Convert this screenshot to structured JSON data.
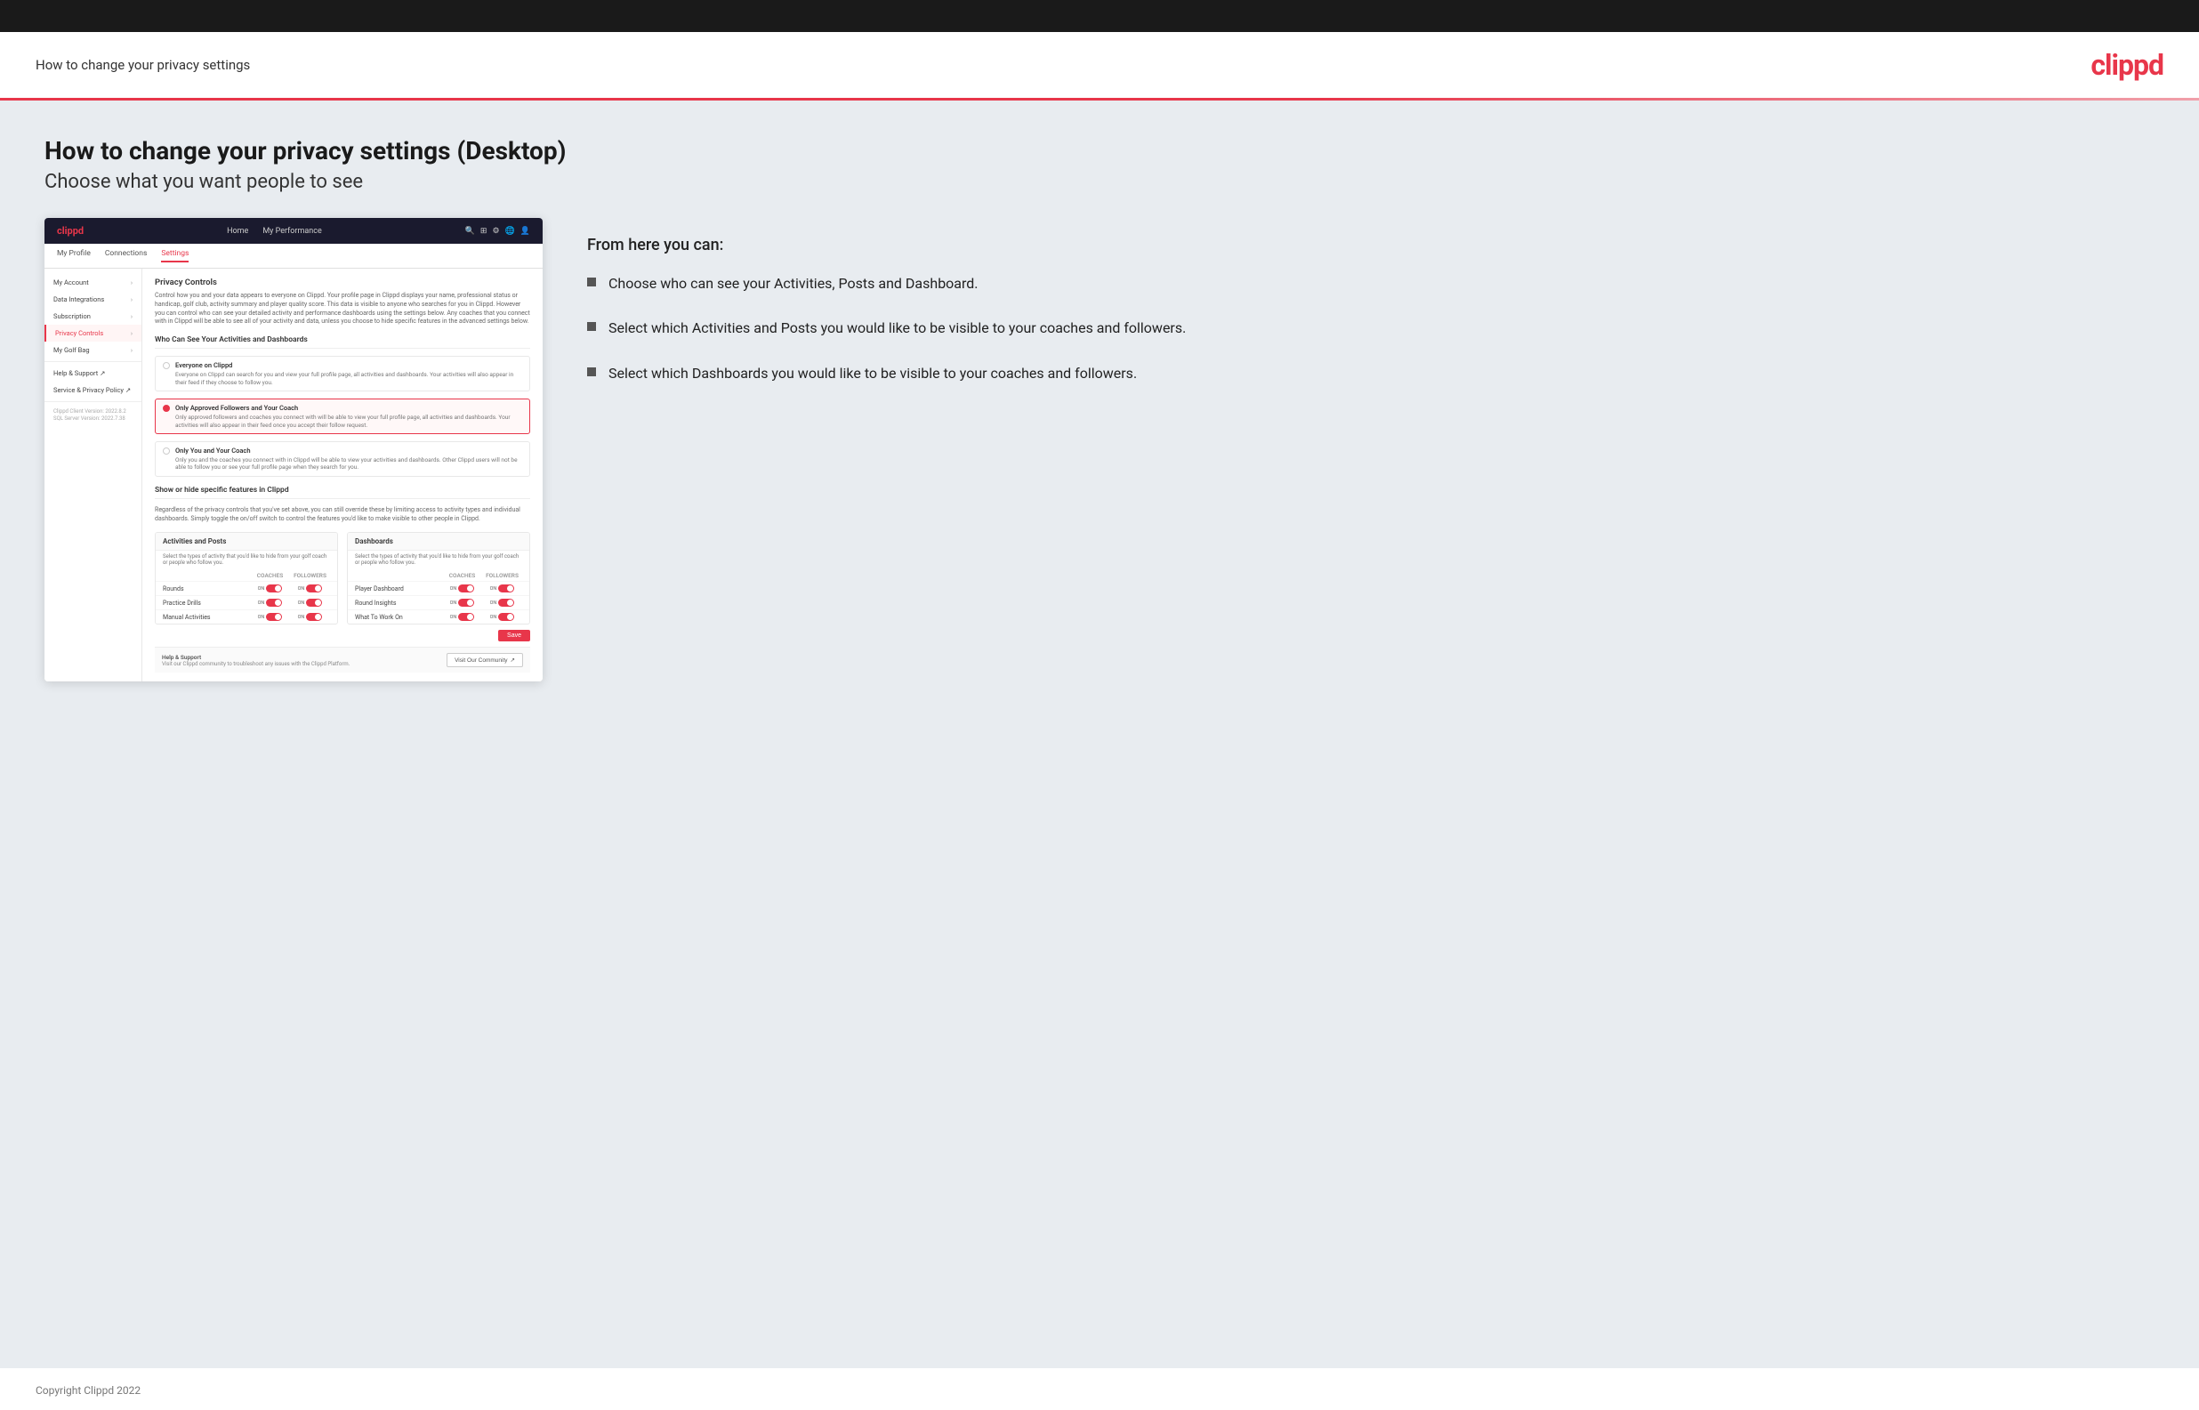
{
  "header": {
    "title": "How to change your privacy settings",
    "logo": "clippd"
  },
  "page": {
    "heading": "How to change your privacy settings (Desktop)",
    "subheading": "Choose what you want people to see"
  },
  "app": {
    "nav": {
      "logo": "clippd",
      "links": [
        "Home",
        "My Performance"
      ],
      "icons": [
        "search",
        "grid",
        "settings",
        "globe",
        "avatar"
      ]
    },
    "subnav": [
      "My Profile",
      "Connections",
      "Settings"
    ],
    "sidebar": {
      "items": [
        {
          "label": "My Account",
          "active": false
        },
        {
          "label": "Data Integrations",
          "active": false
        },
        {
          "label": "Subscription",
          "active": false
        },
        {
          "label": "Privacy Controls",
          "active": true
        },
        {
          "label": "My Golf Bag",
          "active": false
        },
        {
          "label": "Help & Support",
          "active": false,
          "external": true
        },
        {
          "label": "Service & Privacy Policy",
          "active": false,
          "external": true
        }
      ],
      "version": "Clippd Client Version: 2022.8.2\nSQL Server Version: 2022.7.38"
    },
    "main": {
      "privacy_controls_title": "Privacy Controls",
      "privacy_controls_desc": "Control how you and your data appears to everyone on Clippd. Your profile page in Clippd displays your name, professional status or handicap, golf club, activity summary and player quality score. This data is visible to anyone who searches for you in Clippd. However you can control who can see your detailed activity and performance dashboards using the settings below. Any coaches that you connect with in Clippd will be able to see all of your activity and data, unless you choose to hide specific features in the advanced settings below.",
      "who_can_see_title": "Who Can See Your Activities and Dashboards",
      "radio_options": [
        {
          "label": "Everyone on Clippd",
          "desc": "Everyone on Clippd can search for you and view your full profile page, all activities and dashboards. Your activities will also appear in their feed if they choose to follow you.",
          "selected": false
        },
        {
          "label": "Only Approved Followers and Your Coach",
          "desc": "Only approved followers and coaches you connect with will be able to view your full profile page, all activities and dashboards. Your activities will also appear in their feed once you accept their follow request.",
          "selected": true
        },
        {
          "label": "Only You and Your Coach",
          "desc": "Only you and the coaches you connect with in Clippd will be able to view your activities and dashboards. Other Clippd users will not be able to follow you or see your full profile page when they search for you.",
          "selected": false
        }
      ],
      "show_hide_title": "Show or hide specific features in Clippd",
      "show_hide_desc": "Regardless of the privacy controls that you've set above, you can still override these by limiting access to activity types and individual dashboards. Simply toggle the on/off switch to control the features you'd like to make visible to other people in Clippd.",
      "activities_panel": {
        "title": "Activities and Posts",
        "desc": "Select the types of activity that you'd like to hide from your golf coach or people who follow you.",
        "headers": [
          "",
          "COACHES",
          "FOLLOWERS"
        ],
        "rows": [
          {
            "label": "Rounds",
            "coaches_on": true,
            "followers_on": true
          },
          {
            "label": "Practice Drills",
            "coaches_on": true,
            "followers_on": true
          },
          {
            "label": "Manual Activities",
            "coaches_on": true,
            "followers_on": true
          }
        ]
      },
      "dashboards_panel": {
        "title": "Dashboards",
        "desc": "Select the types of activity that you'd like to hide from your golf coach or people who follow you.",
        "headers": [
          "",
          "COACHES",
          "FOLLOWERS"
        ],
        "rows": [
          {
            "label": "Player Dashboard",
            "coaches_on": true,
            "followers_on": true
          },
          {
            "label": "Round Insights",
            "coaches_on": true,
            "followers_on": true
          },
          {
            "label": "What To Work On",
            "coaches_on": true,
            "followers_on": true
          }
        ]
      },
      "save_label": "Save",
      "help": {
        "title": "Help & Support",
        "desc": "Visit our Clippd community to troubleshoot any issues with the Clippd Platform.",
        "button": "Visit Our Community"
      }
    }
  },
  "bullets": {
    "from_here": "From here you can:",
    "items": [
      "Choose who can see your Activities, Posts and Dashboard.",
      "Select which Activities and Posts you would like to be visible to your coaches and followers.",
      "Select which Dashboards you would like to be visible to your coaches and followers."
    ]
  },
  "footer": {
    "copyright": "Copyright Clippd 2022"
  }
}
